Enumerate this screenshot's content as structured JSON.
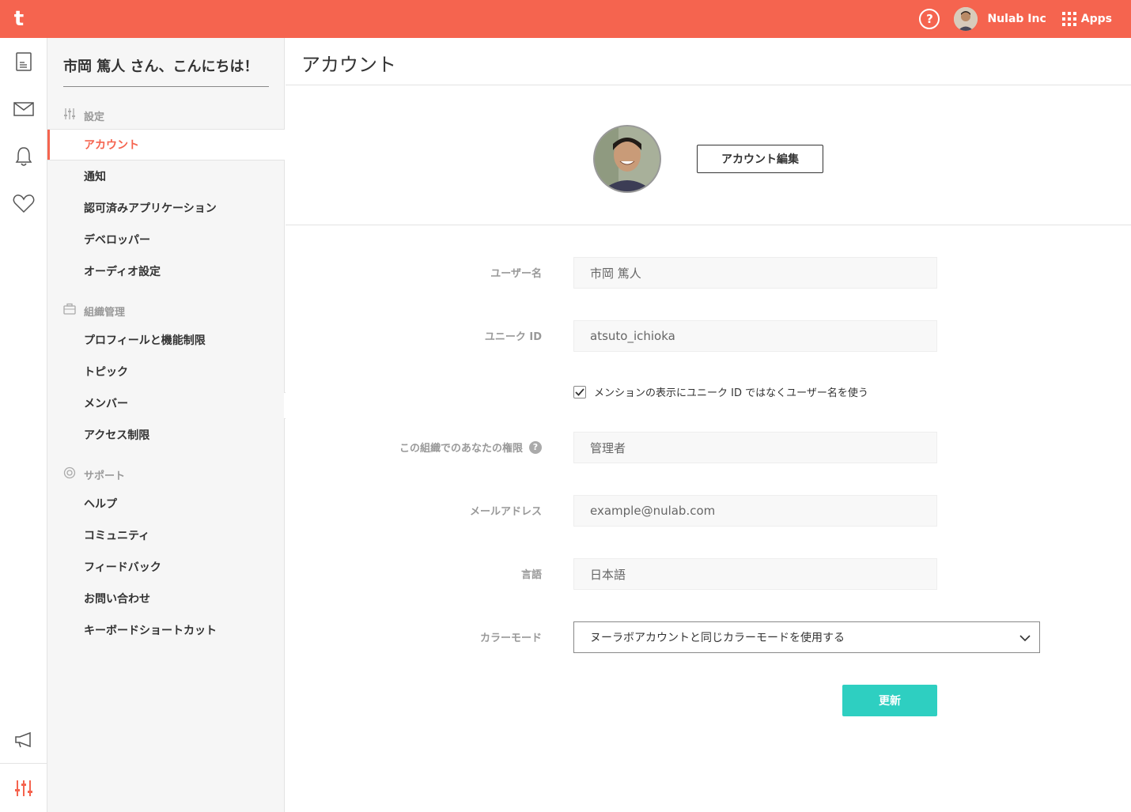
{
  "app": {
    "logo_letter": "t"
  },
  "topbar": {
    "help_label": "?",
    "org_name": "Nulab Inc",
    "apps_label": "Apps"
  },
  "rail": {
    "icons": [
      "document-icon",
      "mail-icon",
      "bell-icon",
      "heart-icon",
      "megaphone-icon",
      "settings-sliders-icon"
    ]
  },
  "panel": {
    "greeting": "市岡 篤人 さん、こんにちは！",
    "sections": [
      {
        "title": "設定",
        "icon": "sliders-icon",
        "items": [
          "アカウント",
          "通知",
          "認可済みアプリケーション",
          "デベロッパー",
          "オーディオ設定"
        ]
      },
      {
        "title": "組織管理",
        "icon": "briefcase-icon",
        "items": [
          "プロフィールと機能制限",
          "トピック",
          "メンバー",
          "アクセス制限"
        ]
      },
      {
        "title": "サポート",
        "icon": "lifebuoy-icon",
        "items": [
          "ヘルプ",
          "コミュニティ",
          "フィードバック",
          "お問い合わせ",
          "キーボードショートカット"
        ]
      }
    ],
    "active_item": "アカウント"
  },
  "main": {
    "title": "アカウント",
    "edit_button": "アカウント編集",
    "form": {
      "username_label": "ユーザー名",
      "username_value": "市岡 篤人",
      "unique_id_label": "ユニーク ID",
      "unique_id_value": "atsuto_ichioka",
      "mention_checkbox_label": "メンションの表示にユニーク ID ではなくユーザー名を使う",
      "mention_checked": true,
      "role_label": "この組織でのあなたの権限",
      "role_value": "管理者",
      "email_label": "メールアドレス",
      "email_value": "example@nulab.com",
      "language_label": "言語",
      "language_value": "日本語",
      "color_mode_label": "カラーモード",
      "color_mode_value": "ヌーラボアカウントと同じカラーモードを使用する",
      "submit_label": "更新"
    }
  },
  "colors": {
    "brand": "#f5644f",
    "submit": "#2ecfc1"
  }
}
